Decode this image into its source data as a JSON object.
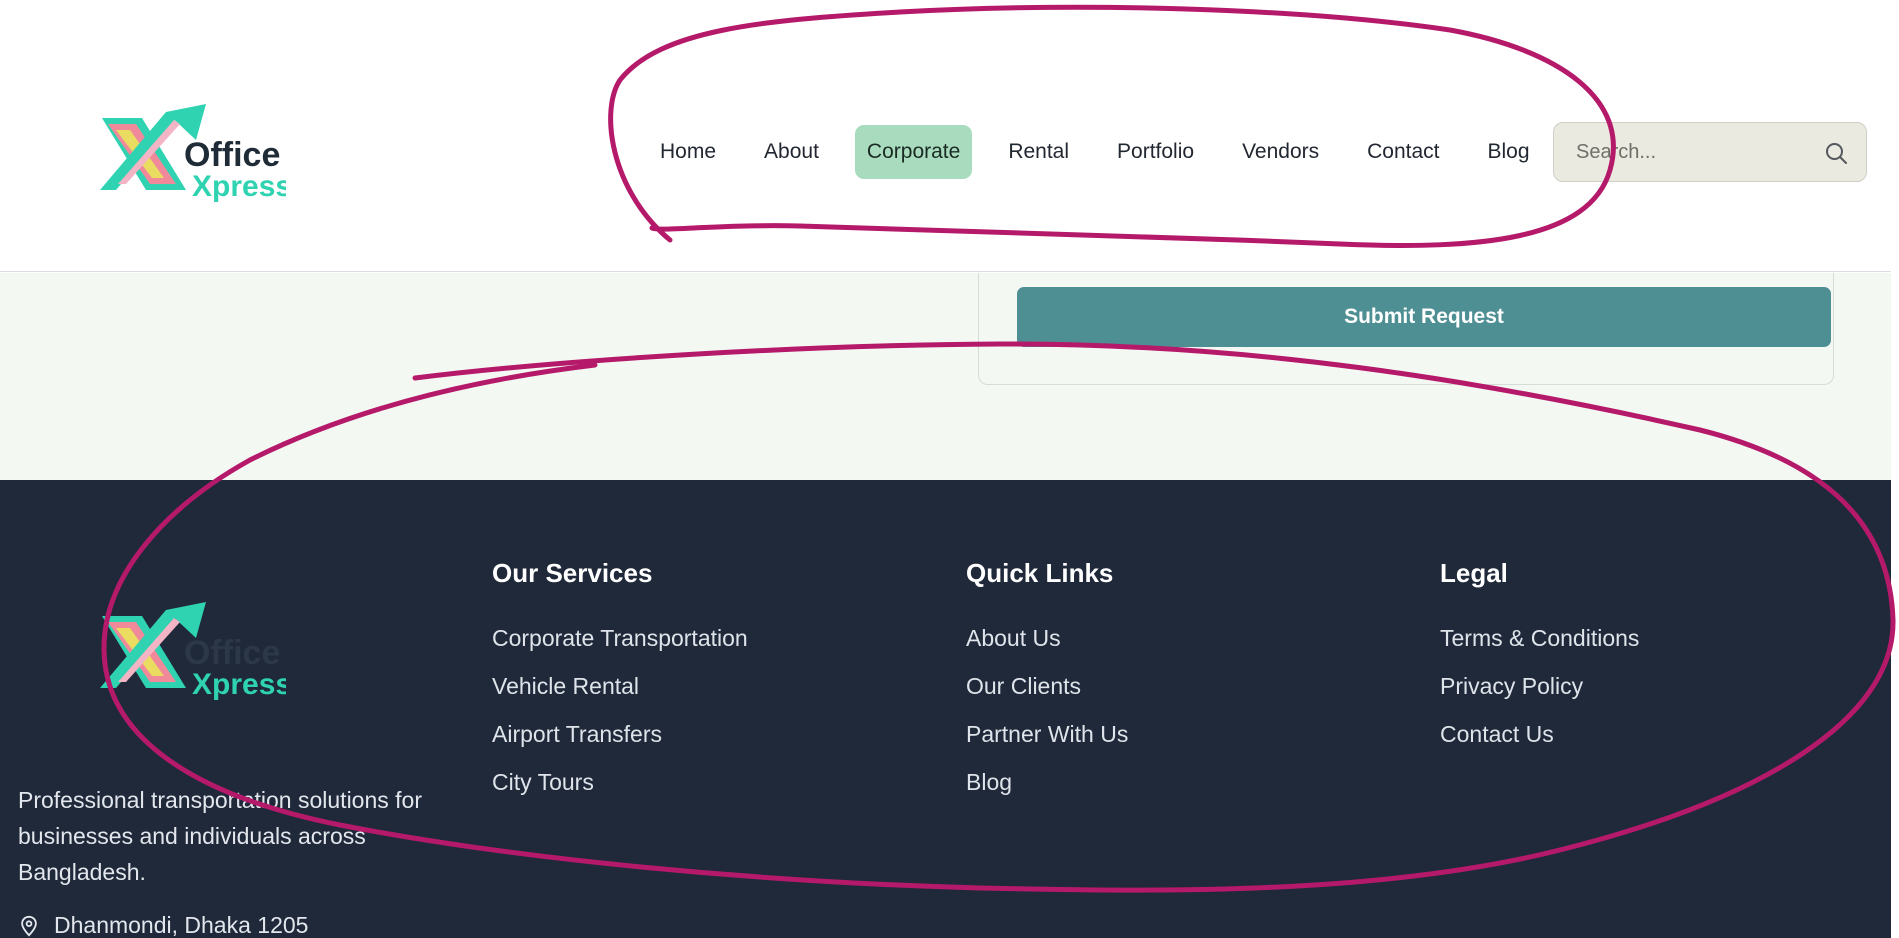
{
  "header": {
    "logo": {
      "line1": "Office",
      "line2": "Xpress"
    },
    "nav": [
      {
        "label": "Home"
      },
      {
        "label": "About"
      },
      {
        "label": "Corporate",
        "active": true
      },
      {
        "label": "Rental"
      },
      {
        "label": "Portfolio"
      },
      {
        "label": "Vendors"
      },
      {
        "label": "Contact"
      },
      {
        "label": "Blog"
      }
    ],
    "search": {
      "placeholder": "Search...",
      "icon": "search-icon"
    }
  },
  "form": {
    "submit_label": "Submit Request"
  },
  "footer": {
    "logo": {
      "line1": "Office",
      "line2": "Xpress"
    },
    "description": "Professional transportation solutions for businesses and individuals across Bangladesh.",
    "address": "Dhanmondi, Dhaka 1205",
    "address_icon": "location-pin-icon",
    "services": {
      "heading": "Our Services",
      "links": [
        "Corporate Transportation",
        "Vehicle Rental",
        "Airport Transfers",
        "City Tours"
      ]
    },
    "quick_links": {
      "heading": "Quick Links",
      "links": [
        "About Us",
        "Our Clients",
        "Partner With Us",
        "Blog"
      ]
    },
    "legal": {
      "heading": "Legal",
      "links": [
        "Terms & Conditions",
        "Privacy Policy",
        "Contact Us"
      ]
    }
  },
  "colors": {
    "nav_active_bg": "#a9dcbf",
    "submit_bg": "#4e8f93",
    "footer_bg": "#1f293a",
    "annotation_stroke": "#b5196a",
    "logo_teal": "#2fd3b1",
    "logo_pink": "#f08a9a",
    "logo_yellow": "#e8e45a"
  }
}
